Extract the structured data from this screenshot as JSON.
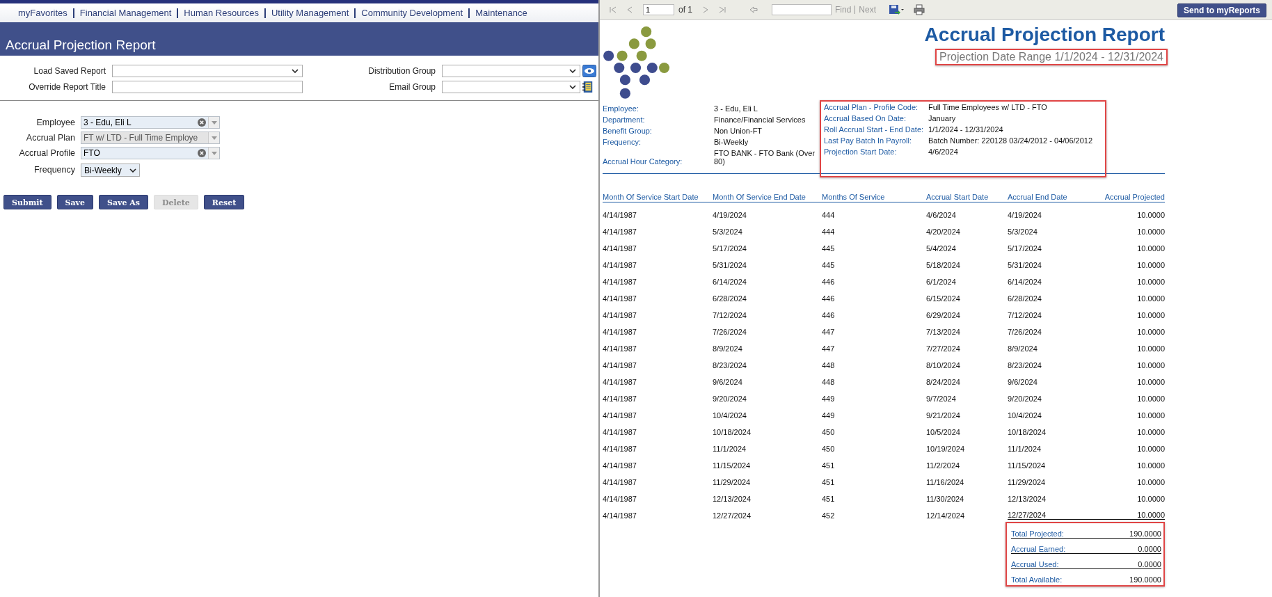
{
  "nav": {
    "items": [
      "myFavorites",
      "Financial Management",
      "Human Resources",
      "Utility Management",
      "Community Development",
      "Maintenance"
    ]
  },
  "page_title": "Accrual Projection Report",
  "form": {
    "fields": [
      {
        "label": "Load Saved Report",
        "kind": "select"
      },
      {
        "label": "Distribution Group",
        "kind": "select-view"
      },
      {
        "label": "Override Report Title",
        "kind": "text"
      },
      {
        "label": "Email Group",
        "kind": "select-book"
      }
    ]
  },
  "criteria": [
    {
      "label": "Employee",
      "value": "3 - Edu, Eli L",
      "kind": "combo",
      "clearable": true,
      "disabled": false
    },
    {
      "label": "Accrual Plan",
      "value": "FT w/ LTD - Full Time Employe",
      "kind": "combo",
      "clearable": false,
      "disabled": true
    },
    {
      "label": "Accrual Profile",
      "value": "FTO",
      "kind": "combo",
      "clearable": true,
      "disabled": false
    },
    {
      "label": "Frequency",
      "value": "Bi-Weekly",
      "kind": "select",
      "clearable": false,
      "disabled": false
    }
  ],
  "buttons": [
    {
      "label": "Submit",
      "disabled": false
    },
    {
      "label": "Save",
      "disabled": false
    },
    {
      "label": "Save As",
      "disabled": false
    },
    {
      "label": "Delete",
      "disabled": true
    },
    {
      "label": "Reset",
      "disabled": false
    }
  ],
  "viewer_toolbar": {
    "page": "1",
    "page_count": "of 1",
    "find": "Find",
    "next": "Next",
    "send_button": "Send to myReports"
  },
  "report": {
    "title": "Accrual Projection Report",
    "date_range": {
      "text": "Projection Date Range 1/1/2024 - 12/31/2024",
      "highlighted": true
    },
    "info_left": [
      {
        "label": "Employee:",
        "value": "3 - Edu, Eli L"
      },
      {
        "label": "Department:",
        "value": "Finance/Financial Services"
      },
      {
        "label": "Benefit Group:",
        "value": "Non Union-FT"
      },
      {
        "label": "Frequency:",
        "value": "Bi-Weekly"
      },
      {
        "label": "Accrual Hour Category:",
        "value": "FTO BANK - FTO Bank (Over 80)"
      }
    ],
    "info_right": {
      "highlighted": true,
      "items": [
        {
          "label": "Accrual Plan - Profile Code:",
          "value": "Full Time Employees w/ LTD - FTO"
        },
        {
          "label": "Accrual Based On Date:",
          "value": "January"
        },
        {
          "label": "Roll Accrual Start - End Date:",
          "value": "1/1/2024 - 12/31/2024"
        },
        {
          "label": "Last Pay Batch In Payroll:",
          "value": "Batch Number: 220128 03/24/2012 - 04/06/2012"
        },
        {
          "label": "Projection Start Date:",
          "value": "4/6/2024"
        }
      ]
    },
    "columns": [
      "Month Of Service Start Date",
      "Month Of Service End Date",
      "Months Of Service",
      "Accrual Start Date",
      "Accrual End Date",
      "Accrual Projected"
    ],
    "rows": [
      [
        "4/14/1987",
        "4/19/2024",
        "444",
        "4/6/2024",
        "4/19/2024",
        "10.0000"
      ],
      [
        "4/14/1987",
        "5/3/2024",
        "444",
        "4/20/2024",
        "5/3/2024",
        "10.0000"
      ],
      [
        "4/14/1987",
        "5/17/2024",
        "445",
        "5/4/2024",
        "5/17/2024",
        "10.0000"
      ],
      [
        "4/14/1987",
        "5/31/2024",
        "445",
        "5/18/2024",
        "5/31/2024",
        "10.0000"
      ],
      [
        "4/14/1987",
        "6/14/2024",
        "446",
        "6/1/2024",
        "6/14/2024",
        "10.0000"
      ],
      [
        "4/14/1987",
        "6/28/2024",
        "446",
        "6/15/2024",
        "6/28/2024",
        "10.0000"
      ],
      [
        "4/14/1987",
        "7/12/2024",
        "446",
        "6/29/2024",
        "7/12/2024",
        "10.0000"
      ],
      [
        "4/14/1987",
        "7/26/2024",
        "447",
        "7/13/2024",
        "7/26/2024",
        "10.0000"
      ],
      [
        "4/14/1987",
        "8/9/2024",
        "447",
        "7/27/2024",
        "8/9/2024",
        "10.0000"
      ],
      [
        "4/14/1987",
        "8/23/2024",
        "448",
        "8/10/2024",
        "8/23/2024",
        "10.0000"
      ],
      [
        "4/14/1987",
        "9/6/2024",
        "448",
        "8/24/2024",
        "9/6/2024",
        "10.0000"
      ],
      [
        "4/14/1987",
        "9/20/2024",
        "449",
        "9/7/2024",
        "9/20/2024",
        "10.0000"
      ],
      [
        "4/14/1987",
        "10/4/2024",
        "449",
        "9/21/2024",
        "10/4/2024",
        "10.0000"
      ],
      [
        "4/14/1987",
        "10/18/2024",
        "450",
        "10/5/2024",
        "10/18/2024",
        "10.0000"
      ],
      [
        "4/14/1987",
        "11/1/2024",
        "450",
        "10/19/2024",
        "11/1/2024",
        "10.0000"
      ],
      [
        "4/14/1987",
        "11/15/2024",
        "451",
        "11/2/2024",
        "11/15/2024",
        "10.0000"
      ],
      [
        "4/14/1987",
        "11/29/2024",
        "451",
        "11/16/2024",
        "11/29/2024",
        "10.0000"
      ],
      [
        "4/14/1987",
        "12/13/2024",
        "451",
        "11/30/2024",
        "12/13/2024",
        "10.0000"
      ],
      [
        "4/14/1987",
        "12/27/2024",
        "452",
        "12/14/2024",
        "12/27/2024",
        "10.0000"
      ]
    ],
    "totals": {
      "highlighted": true,
      "items": [
        {
          "label": "Total Projected:",
          "value": "190.0000"
        },
        {
          "label": "Accrual Earned:",
          "value": "0.0000"
        },
        {
          "label": "Accrual Used:",
          "value": "0.0000"
        },
        {
          "label": "Total Available:",
          "value": "190.0000"
        }
      ]
    }
  }
}
